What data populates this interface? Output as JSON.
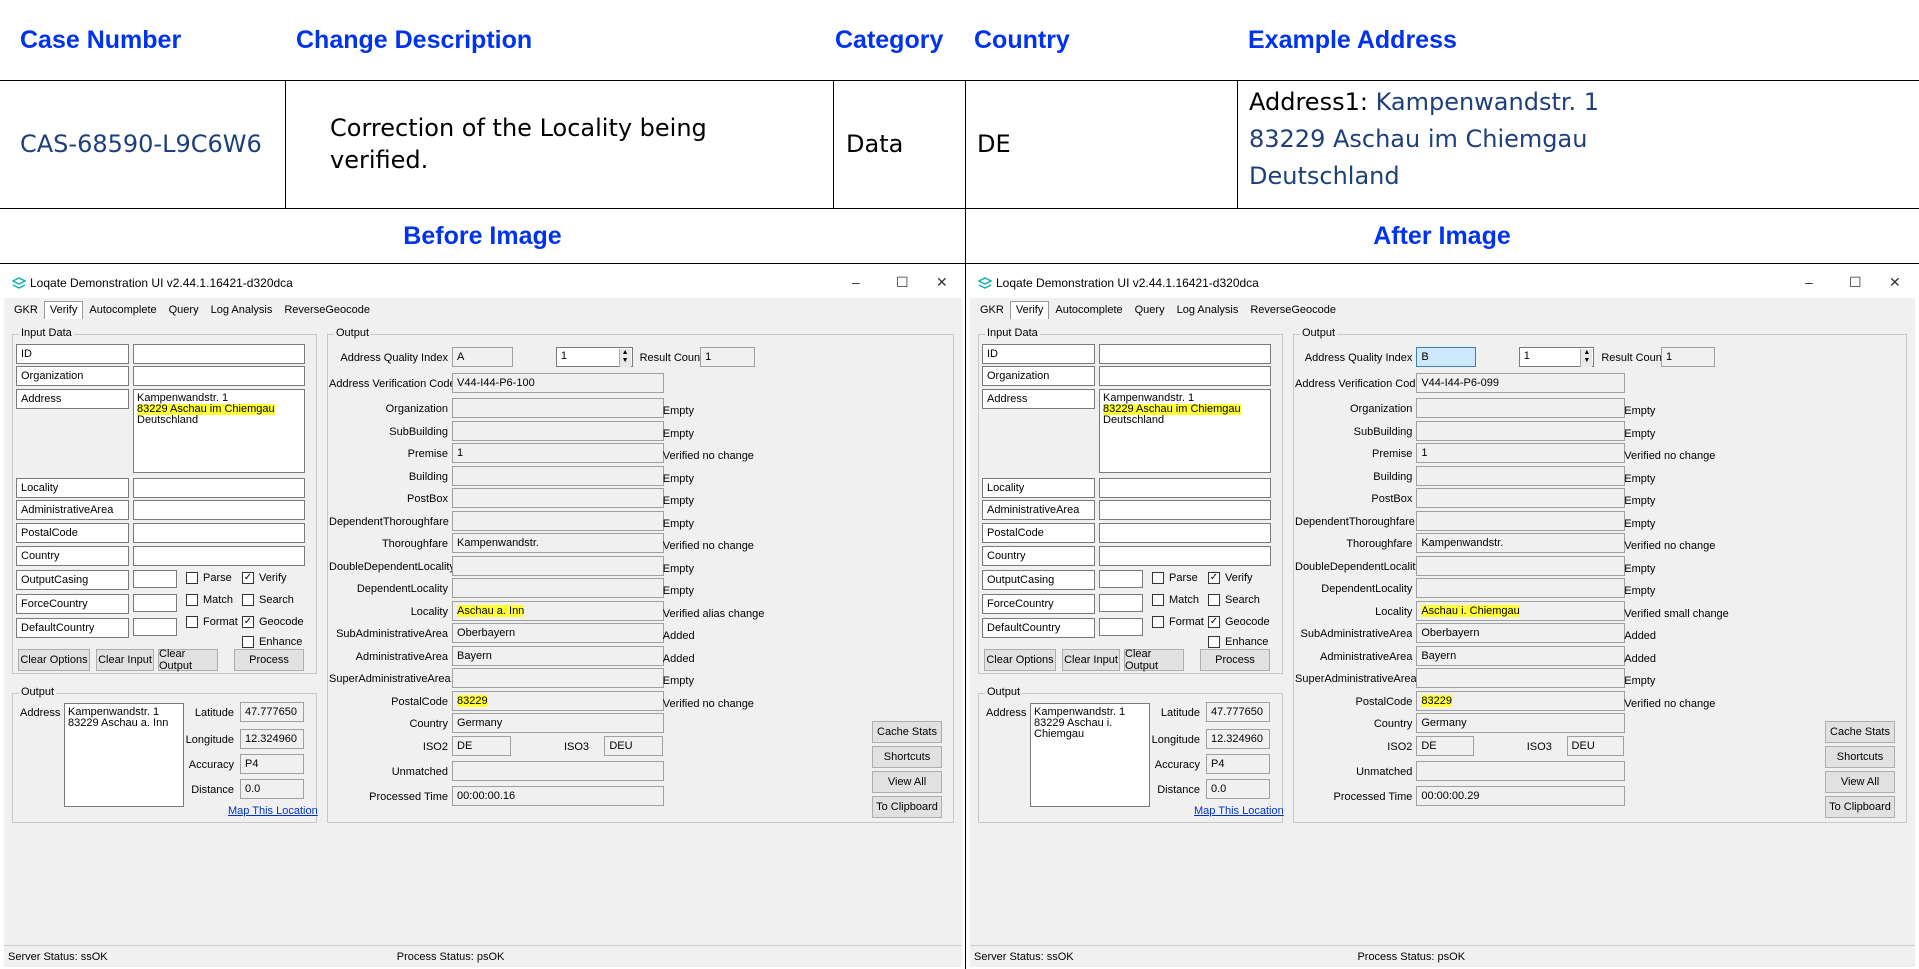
{
  "headers": {
    "case_number": "Case Number",
    "change_description": "Change Description",
    "category": "Category",
    "country": "Country",
    "example_address": "Example Address"
  },
  "row": {
    "case_number": "CAS-68590-L9C6W6",
    "change_description": "Correction of the Locality being verified.",
    "category": "Data",
    "country": "DE",
    "address_prefix": "Address1: ",
    "address_line1": "Kampenwandstr. 1",
    "address_line2": "83229 Aschau im Chiemgau",
    "address_line3": "Deutschland"
  },
  "labels": {
    "before": "Before Image",
    "after": "After Image"
  },
  "app": {
    "title": "Loqate Demonstration UI v2.44.1.16421-d320dca",
    "window_controls": {
      "minimize": "–",
      "maximize": "☐",
      "close": "✕"
    },
    "tabs": [
      "GKR",
      "Verify",
      "Autocomplete",
      "Query",
      "Log Analysis",
      "ReverseGeocode"
    ],
    "input_data": {
      "group": "Input Data",
      "fields": [
        "ID",
        "Organization",
        "Address",
        "Locality",
        "AdministrativeArea",
        "PostalCode",
        "Country"
      ],
      "address_lines": [
        "Kampenwandstr. 1",
        "83229 Aschau im Chiemgau",
        "Deutschland"
      ],
      "options": [
        "OutputCasing",
        "ForceCountry",
        "DefaultCountry"
      ],
      "checkboxes": {
        "parse": "Parse",
        "match": "Match",
        "format": "Format",
        "verify": "Verify",
        "search": "Search",
        "geocode": "Geocode",
        "enhance": "Enhance"
      },
      "buttons": {
        "clear_options": "Clear Options",
        "clear_input": "Clear Input",
        "clear_output": "Clear Output",
        "process": "Process"
      }
    },
    "output_labels": {
      "group": "Output",
      "aqi": "Address Quality Index",
      "result_count": "Result Count",
      "avc": "Address Verification Code",
      "fields": [
        "Organization",
        "SubBuilding",
        "Premise",
        "Building",
        "PostBox",
        "DependentThoroughfare",
        "Thoroughfare",
        "DoubleDependentLocality",
        "DependentLocality",
        "Locality",
        "SubAdministrativeArea",
        "AdministrativeArea",
        "SuperAdministrativeArea",
        "PostalCode",
        "Country"
      ],
      "iso2": "ISO2",
      "iso3": "ISO3",
      "unmatched": "Unmatched",
      "processed_time": "Processed Time",
      "buttons": {
        "cache_stats": "Cache Stats",
        "shortcuts": "Shortcuts",
        "view_all": "View All",
        "to_clipboard": "To Clipboard"
      }
    },
    "geo_labels": {
      "group": "Output",
      "address": "Address",
      "latitude": "Latitude",
      "longitude": "Longitude",
      "accuracy": "Accuracy",
      "distance": "Distance",
      "map_link": "Map This Location"
    },
    "status_labels": {
      "server": "Server Status: ssOK",
      "process": "Process Status: psOK"
    }
  },
  "before": {
    "aqi": "A",
    "spin": "1",
    "result_count": "1",
    "avc": "V44-I44-P6-100",
    "values": [
      "",
      "",
      "1",
      "",
      "",
      "",
      "Kampenwandstr.",
      "",
      "",
      "Aschau a. Inn",
      "Oberbayern",
      "Bayern",
      "",
      "83229",
      "Germany"
    ],
    "statuses": [
      "Empty",
      "Empty",
      "Verified no change",
      "Empty",
      "Empty",
      "Empty",
      "Verified no change",
      "Empty",
      "Empty",
      "Verified alias change",
      "Added",
      "Added",
      "Empty",
      "Verified no change",
      ""
    ],
    "iso2": "DE",
    "iso3": "DEU",
    "unmatched": "",
    "processed_time": "00:00:00.16",
    "geo": {
      "address_lines": [
        "Kampenwandstr. 1",
        "83229 Aschau a. Inn"
      ],
      "latitude": "47.777650",
      "longitude": "12.324960",
      "accuracy": "P4",
      "distance": "0.0"
    }
  },
  "after": {
    "aqi": "B",
    "spin": "1",
    "result_count": "1",
    "avc": "V44-I44-P6-099",
    "values": [
      "",
      "",
      "1",
      "",
      "",
      "",
      "Kampenwandstr.",
      "",
      "",
      "Aschau i. Chiemgau",
      "Oberbayern",
      "Bayern",
      "",
      "83229",
      "Germany"
    ],
    "statuses": [
      "Empty",
      "Empty",
      "Verified no change",
      "Empty",
      "Empty",
      "Empty",
      "Verified no change",
      "Empty",
      "Empty",
      "Verified small change",
      "Added",
      "Added",
      "Empty",
      "Verified no change",
      ""
    ],
    "iso2": "DE",
    "iso3": "DEU",
    "unmatched": "",
    "processed_time": "00:00:00.29",
    "geo": {
      "address_lines": [
        "Kampenwandstr. 1",
        "83229 Aschau i. Chiemgau"
      ],
      "latitude": "47.777650",
      "longitude": "12.324960",
      "accuracy": "P4",
      "distance": "0.0"
    }
  },
  "colors": {
    "header_blue": "#0033ee",
    "address_blue": "#1f3f7a",
    "highlight": "#ffff33",
    "window_bg": "#f0f0f0"
  },
  "icons": {
    "logo": "loqate-logo-icon",
    "dropdown": "chevron-down-icon",
    "checkbox": "checkbox-icon"
  }
}
